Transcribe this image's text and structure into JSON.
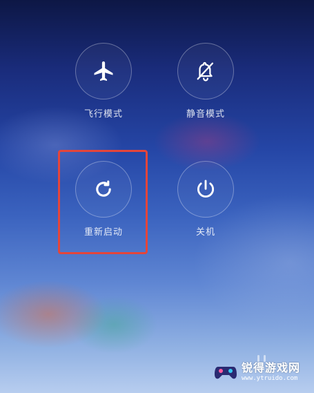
{
  "power_menu": {
    "airplane_mode": {
      "label": "飞行模式",
      "icon": "airplane-icon"
    },
    "silent_mode": {
      "label": "静音模式",
      "icon": "bell-off-icon"
    },
    "restart": {
      "label": "重新启动",
      "icon": "restart-icon",
      "highlight_color": "#e5453a"
    },
    "power_off": {
      "label": "关机",
      "icon": "power-icon"
    }
  },
  "watermark": {
    "title": "锐得游戏网",
    "url": "www.ytruido.com"
  }
}
